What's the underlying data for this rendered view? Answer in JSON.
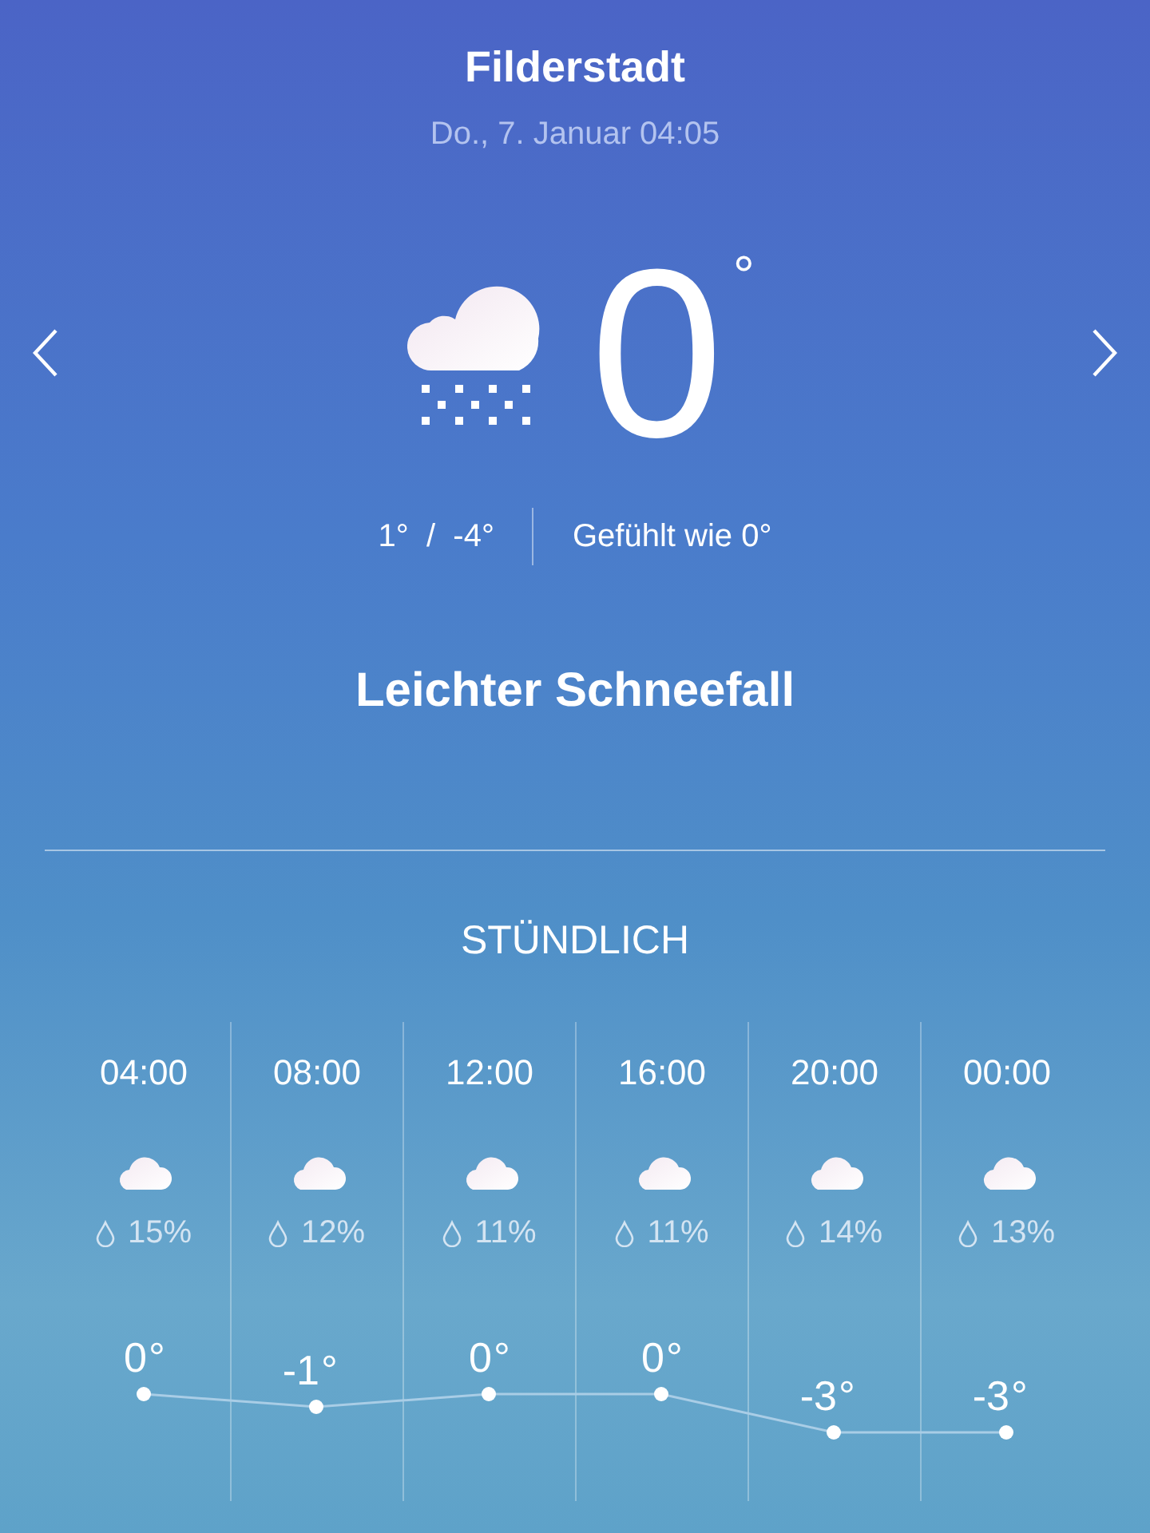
{
  "location": {
    "name": "Filderstadt",
    "datetime": "Do., 7. Januar 04:05"
  },
  "current": {
    "temperature": "0",
    "unit": "°",
    "range": "1°  /  -4°",
    "feels_like": "Gefühlt wie 0°",
    "condition": "Leichter Schneefall"
  },
  "hourly": {
    "title": "STÜNDLICH",
    "hours": [
      {
        "time": "04:00",
        "precipitation": "15%",
        "degree": "°"
      },
      {
        "time": "08:00",
        "precipitation": "12%",
        "degree": "°"
      },
      {
        "time": "12:00",
        "precipitation": "11%",
        "degree": "°"
      },
      {
        "time": "16:00",
        "precipitation": "11%",
        "degree": "°"
      },
      {
        "time": "20:00",
        "precipitation": "14%",
        "degree": "°"
      },
      {
        "time": "00:00",
        "precipitation": "13%",
        "degree": "°"
      }
    ],
    "chart_data": {
      "type": "line",
      "categories": [
        null,
        null,
        null,
        null,
        null,
        null
      ],
      "series": [
        {
          "color": "#a9cde6",
          "marker": "circle",
          "values": [
            0,
            -1,
            0,
            0,
            -3,
            -3
          ]
        }
      ],
      "data_labels": true
    }
  }
}
